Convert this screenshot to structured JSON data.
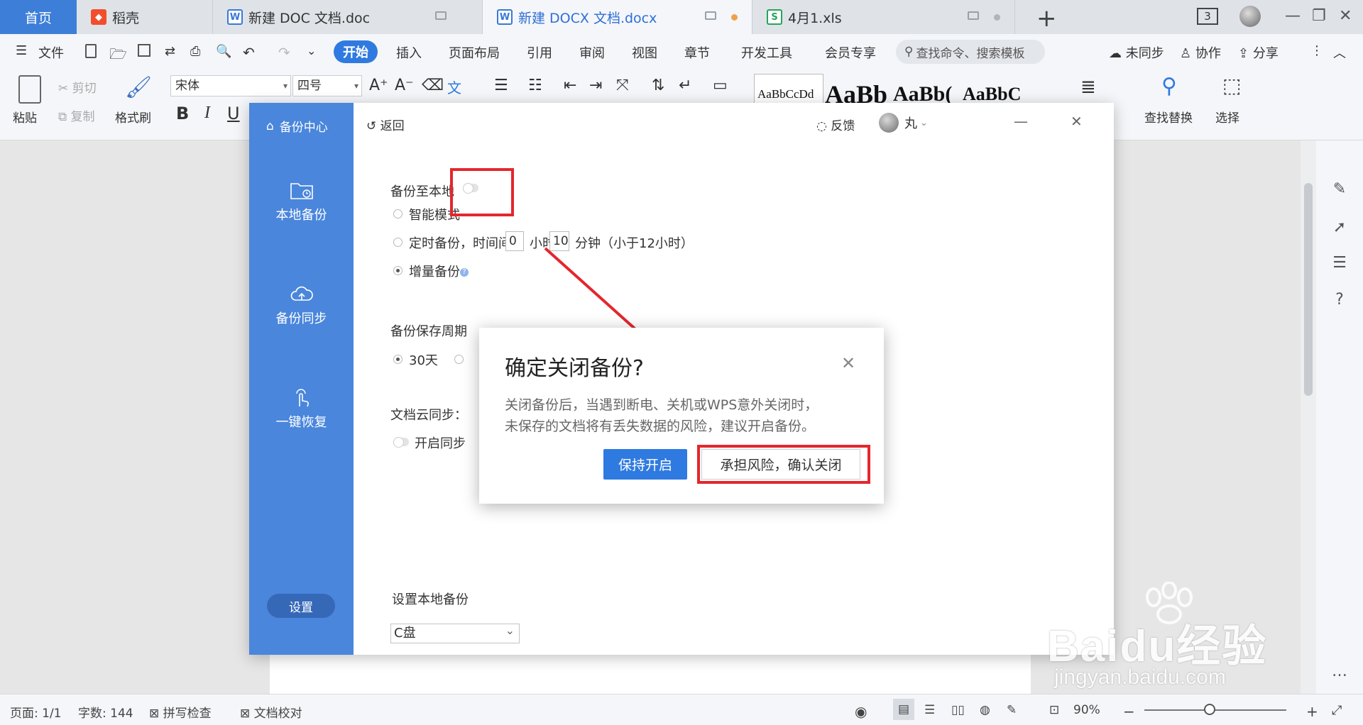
{
  "tabs": [
    {
      "label": "首页"
    },
    {
      "label": "稻壳"
    },
    {
      "label": "新建 DOC 文档.doc"
    },
    {
      "label": "新建 DOCX 文档.docx"
    },
    {
      "label": "4月1.xls"
    }
  ],
  "window": {
    "count_badge": "3"
  },
  "menu": {
    "file": "文件",
    "items": [
      "开始",
      "插入",
      "页面布局",
      "引用",
      "审阅",
      "视图",
      "章节",
      "开发工具",
      "会员专享"
    ],
    "search_placeholder": "查找命令、搜索模板",
    "right": [
      "未同步",
      "协作",
      "分享"
    ]
  },
  "ribbon": {
    "paste": "粘贴",
    "cut": "剪切",
    "copy": "复制",
    "format_painter": "格式刷",
    "font_name": "宋体",
    "font_size": "四号",
    "bold": "B",
    "italic": "I",
    "underline": "U",
    "styles": [
      "AaBbCcDd",
      "AaBb",
      "AaBb(",
      "AaBbC"
    ],
    "find_replace": "查找替换",
    "select": "选择"
  },
  "backup_panel": {
    "title": "备份中心",
    "back": "返回",
    "feedback": "反馈",
    "user": "丸",
    "sidebar": [
      "本地备份",
      "备份同步",
      "一键恢复"
    ],
    "settings": "设置",
    "local_backup_label": "备份至本地",
    "smart_mode": "智能模式",
    "timed_backup": "定时备份，时间间隔",
    "hours_value": "0",
    "hours_unit": "小时",
    "minutes_value": "10",
    "minutes_unit": "分钟（小于12小时）",
    "incremental": "增量备份",
    "retention_label": "备份保存周期",
    "retention_30": "30天",
    "cloud_sync_label": "文档云同步：",
    "enable_sync": "开启同步",
    "location_label": "设置本地备份",
    "drive": "C盘"
  },
  "dialog": {
    "title": "确定关闭备份?",
    "message_line1": "关闭备份后，当遇到断电、关机或WPS意外关闭时，",
    "message_line2": "未保存的文档将有丢失数据的风险，建议开启备份。",
    "keep_button": "保持开启",
    "confirm_button": "承担风险，确认关闭"
  },
  "status": {
    "page": "页面: 1/1",
    "words": "字数: 144",
    "spell": "拼写检查",
    "proof": "文档校对",
    "zoom": "90%"
  },
  "watermark": {
    "main": "Baidu经验",
    "sub": "jingyan.baidu.com"
  },
  "colors": {
    "accent": "#2f7ae0",
    "sidebar": "#4a86dc",
    "highlight": "#e3272d"
  }
}
